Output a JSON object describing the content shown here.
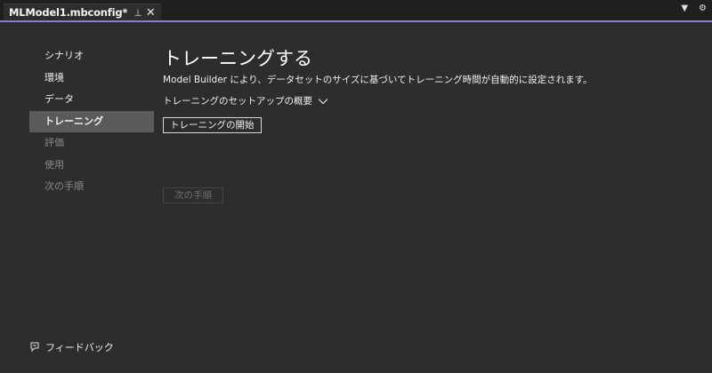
{
  "tab": {
    "title": "MLModel1.mbconfig*",
    "pin_icon": "pin-icon",
    "close_icon": "close-icon"
  },
  "strip": {
    "dropdown_icon": "chevron-down-icon",
    "settings_icon": "gear-icon"
  },
  "sidebar": {
    "items": [
      {
        "label": "シナリオ",
        "state": "normal"
      },
      {
        "label": "環境",
        "state": "normal"
      },
      {
        "label": "データ",
        "state": "normal"
      },
      {
        "label": "トレーニング",
        "state": "active"
      },
      {
        "label": "評価",
        "state": "disabled"
      },
      {
        "label": "使用",
        "state": "disabled"
      },
      {
        "label": "次の手順",
        "state": "disabled"
      }
    ],
    "feedback_label": "フィードバック"
  },
  "main": {
    "title": "トレーニングする",
    "description": "Model Builder により、データセットのサイズに基づいてトレーニング時間が自動的に設定されます。",
    "overview_label": "トレーニングのセットアップの概要",
    "start_button": "トレーニングの開始",
    "next_button": "次の手順"
  },
  "colors": {
    "accent": "#8b7bd8",
    "background": "#2d2d2d",
    "active_item": "#5a5a5a"
  }
}
